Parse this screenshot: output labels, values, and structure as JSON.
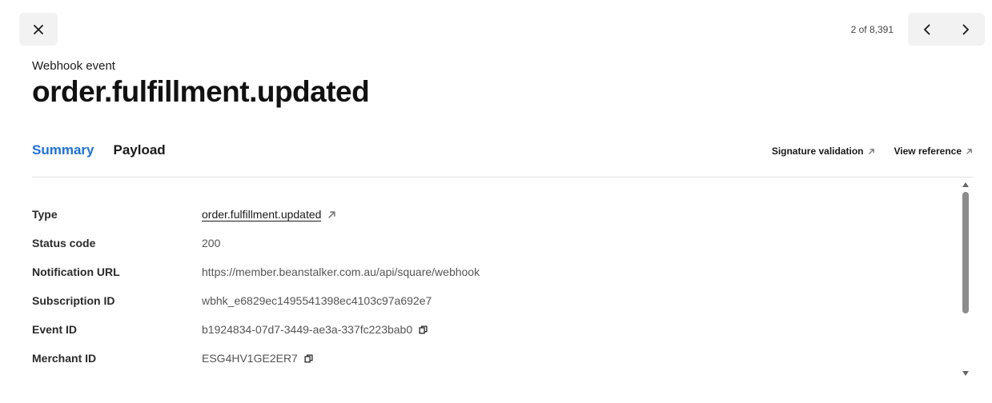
{
  "header": {
    "close_icon": "close-icon",
    "pager_count": "2 of 8,391",
    "prev_icon": "chevron-left-icon",
    "next_icon": "chevron-right-icon"
  },
  "event": {
    "eyebrow": "Webhook event",
    "title": "order.fulfillment.updated"
  },
  "tabs": [
    {
      "label": "Summary",
      "active": true
    },
    {
      "label": "Payload",
      "active": false
    }
  ],
  "links": {
    "signature_validation": "Signature validation",
    "view_reference": "View reference"
  },
  "details": {
    "type": {
      "label": "Type",
      "value": "order.fulfillment.updated"
    },
    "status_code": {
      "label": "Status code",
      "value": "200"
    },
    "notification_url": {
      "label": "Notification URL",
      "value": "https://member.beanstalker.com.au/api/square/webhook"
    },
    "subscription_id": {
      "label": "Subscription ID",
      "value": "wbhk_e6829ec1495541398ec4103c97a692e7"
    },
    "event_id": {
      "label": "Event ID",
      "value": "b1924834-07d7-3449-ae3a-337fc223bab0"
    },
    "merchant_id": {
      "label": "Merchant ID",
      "value": "ESG4HV1GE2ER7"
    }
  },
  "colors": {
    "accent": "#1c72d6",
    "button_bg": "#f2f2f2",
    "divider": "#e3e3e3"
  }
}
